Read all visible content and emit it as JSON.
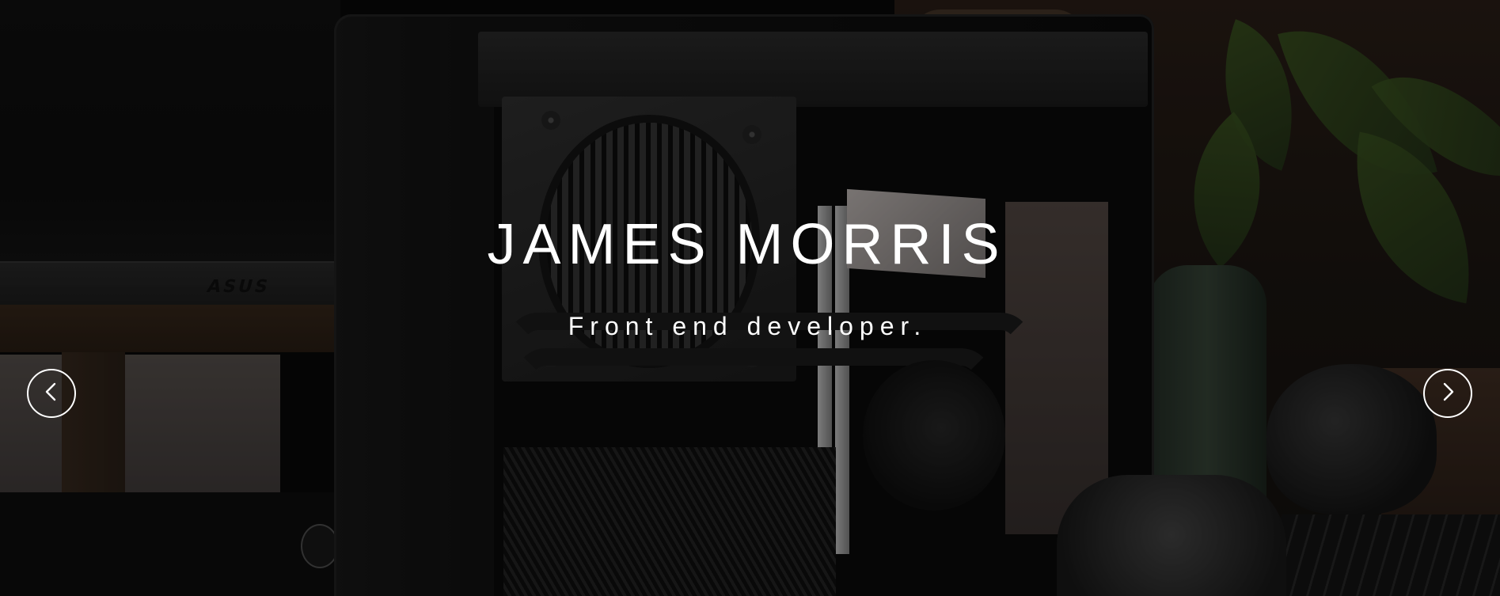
{
  "hero": {
    "title": "JAMES MORRIS",
    "subtitle": "Front end developer.",
    "background": {
      "monitor_logo": "ASUS"
    }
  },
  "carousel": {
    "prev_icon": "chevron-left-icon",
    "next_icon": "chevron-right-icon"
  },
  "colors": {
    "text": "#ffffff",
    "arrow_border": "#ffffff",
    "overlay": "#000000"
  }
}
